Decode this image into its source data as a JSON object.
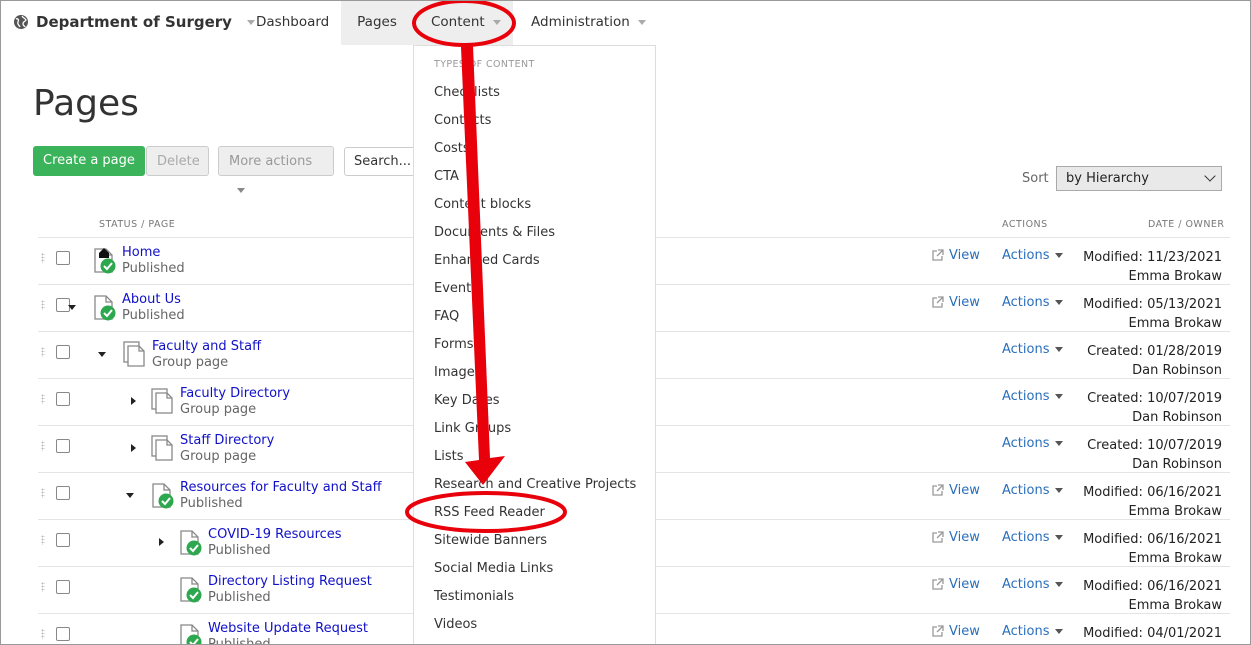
{
  "nav": {
    "site_title": "Department of Surgery",
    "items": [
      {
        "label": "Dashboard"
      },
      {
        "label": "Pages"
      },
      {
        "label": "Content"
      },
      {
        "label": "Administration"
      }
    ]
  },
  "page": {
    "title": "Pages",
    "create_label": "Create a page",
    "delete_label": "Delete",
    "more_actions_label": "More actions",
    "search_placeholder": "Search...",
    "sort_label": "Sort",
    "sort_value": "by Hierarchy"
  },
  "table": {
    "col_status": "STATUS / PAGE",
    "col_actions": "ACTIONS",
    "col_date": "DATE / OWNER",
    "view_label": "View",
    "actions_label": "Actions",
    "rows": [
      {
        "name": "Home",
        "status": "Published",
        "date": "Modified: 11/23/2021",
        "owner": "Emma Brokaw"
      },
      {
        "name": "About Us",
        "status": "Published",
        "date": "Modified: 05/13/2021",
        "owner": "Emma Brokaw"
      },
      {
        "name": "Faculty and Staff",
        "status": "Group page",
        "date": "Created: 01/28/2019",
        "owner": "Dan Robinson"
      },
      {
        "name": "Faculty Directory",
        "status": "Group page",
        "date": "Created: 10/07/2019",
        "owner": "Dan Robinson"
      },
      {
        "name": "Staff Directory",
        "status": "Group page",
        "date": "Created: 10/07/2019",
        "owner": "Dan Robinson"
      },
      {
        "name": "Resources for Faculty and Staff",
        "status": "Published",
        "date": "Modified: 06/16/2021",
        "owner": "Emma Brokaw"
      },
      {
        "name": "COVID-19 Resources",
        "status": "Published",
        "date": "Modified: 06/16/2021",
        "owner": "Emma Brokaw"
      },
      {
        "name": "Directory Listing Request",
        "status": "Published",
        "date": "Modified: 06/16/2021",
        "owner": "Emma Brokaw"
      },
      {
        "name": "Website Update Request",
        "status": "Published",
        "date": "Modified: 04/01/2021",
        "owner": ""
      }
    ]
  },
  "content_menu": {
    "heading": "TYPES OF CONTENT",
    "items": [
      "Checklists",
      "Contacts",
      "Costs",
      "CTA",
      "Content blocks",
      "Documents & Files",
      "Enhanced Cards",
      "Events",
      "FAQ",
      "Forms",
      "Images",
      "Key Dates",
      "Link Groups",
      "Lists",
      "Research and Creative Projects",
      "RSS Feed Reader",
      "Sitewide Banners",
      "Social Media Links",
      "Testimonials",
      "Videos"
    ]
  },
  "colors": {
    "accent_green": "#3ab35a",
    "link_blue": "#1010c8",
    "action_blue": "#2a6ebb",
    "annotation_red": "#e8000b"
  },
  "icons": [
    "globe-icon",
    "home-icon",
    "page-icon",
    "check-icon",
    "external-link-icon",
    "grip-icon",
    "chevron-down-icon"
  ]
}
